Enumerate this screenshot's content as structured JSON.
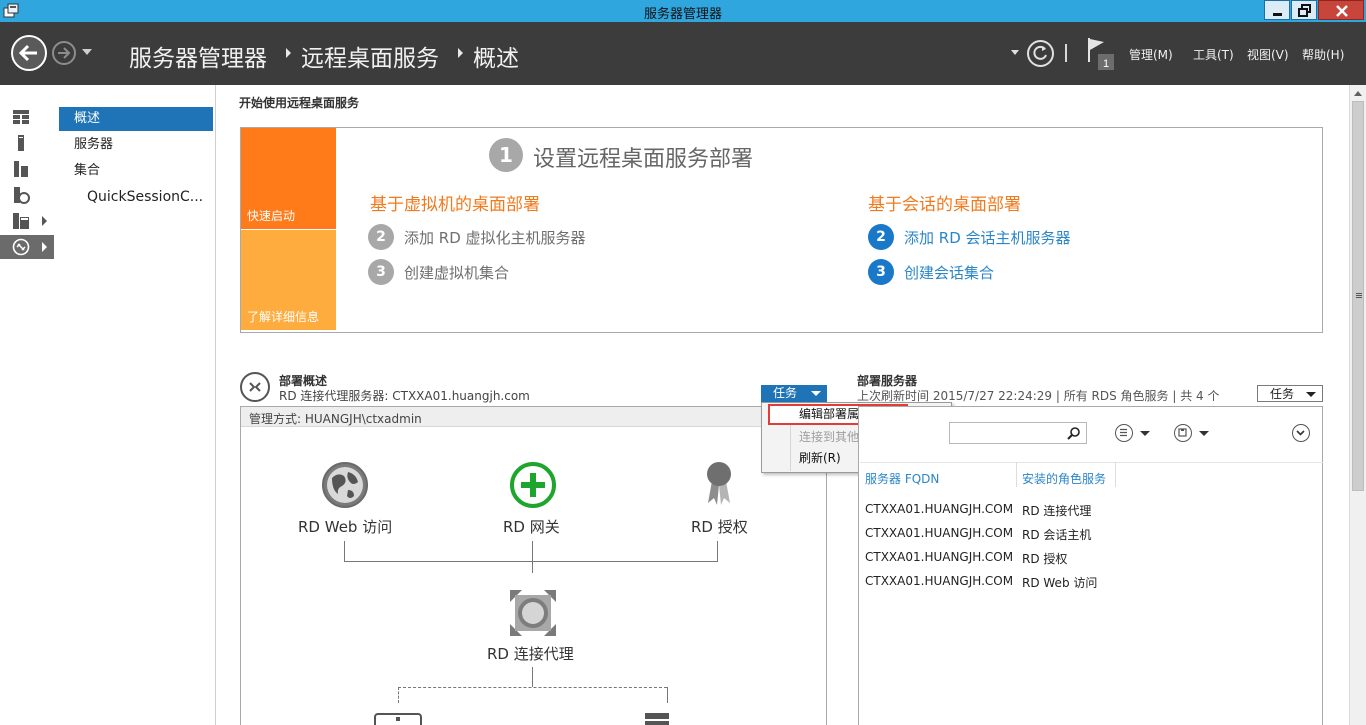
{
  "window": {
    "title": "服务器管理器"
  },
  "header": {
    "breadcrumbs": [
      "服务器管理器",
      "远程桌面服务",
      "概述"
    ],
    "notification_count": "1",
    "menus": [
      "管理(M)",
      "工具(T)",
      "视图(V)",
      "帮助(H)"
    ]
  },
  "subnav": {
    "items": [
      {
        "label": "概述",
        "selected": true
      },
      {
        "label": "服务器"
      },
      {
        "label": "集合"
      },
      {
        "label": "QuickSessionC..."
      }
    ]
  },
  "quickstart": {
    "section_title": "开始使用远程桌面服务",
    "tiles": [
      "快速启动",
      "了解详细信息"
    ],
    "step1_number": "1",
    "step1_title": "设置远程桌面服务部署",
    "vm_column": {
      "heading": "基于虚拟机的桌面部署",
      "steps": [
        {
          "number": "2",
          "label": "添加 RD 虚拟化主机服务器"
        },
        {
          "number": "3",
          "label": "创建虚拟机集合"
        }
      ]
    },
    "session_column": {
      "heading": "基于会话的桌面部署",
      "steps": [
        {
          "number": "2",
          "label": "添加 RD 会话主机服务器"
        },
        {
          "number": "3",
          "label": "创建会话集合"
        }
      ]
    }
  },
  "deployment_overview": {
    "title": "部署概述",
    "subtitle": "RD 连接代理服务器: CTXXA01.huangjh.com",
    "tasks_label": "任务",
    "managed_by": "管理方式: HUANGJH\\ctxadmin",
    "roles": [
      "RD Web 访问",
      "RD 网关",
      "RD 授权",
      "RD 连接代理"
    ]
  },
  "context_menu": {
    "items": [
      {
        "label": "编辑部署属性(E)",
        "state": "highlighted"
      },
      {
        "label": "连接到其他部署(C)",
        "state": "disabled"
      },
      {
        "label": "刷新(R)",
        "state": "normal"
      }
    ]
  },
  "deployment_servers": {
    "title": "部署服务器",
    "subtitle": "上次刷新时间 2015/7/27 22:24:29 | 所有 RDS 角色服务  | 共 4 个",
    "tasks_label": "任务",
    "columns": [
      "服务器 FQDN",
      "安装的角色服务"
    ],
    "rows": [
      [
        "CTXXA01.HUANGJH.COM",
        "RD 连接代理"
      ],
      [
        "CTXXA01.HUANGJH.COM",
        "RD 会话主机"
      ],
      [
        "CTXXA01.HUANGJH.COM",
        "RD 授权"
      ],
      [
        "CTXXA01.HUANGJH.COM",
        "RD Web 访问"
      ]
    ]
  },
  "colors": {
    "titlebar": "#2fa6de",
    "header": "#3c3c3c",
    "selection_blue": "#1f73b7",
    "orange": "#ff7a19",
    "light_orange": "#ffac3e",
    "link_blue": "#2b86c8",
    "highlight_red": "#e23b3b"
  }
}
